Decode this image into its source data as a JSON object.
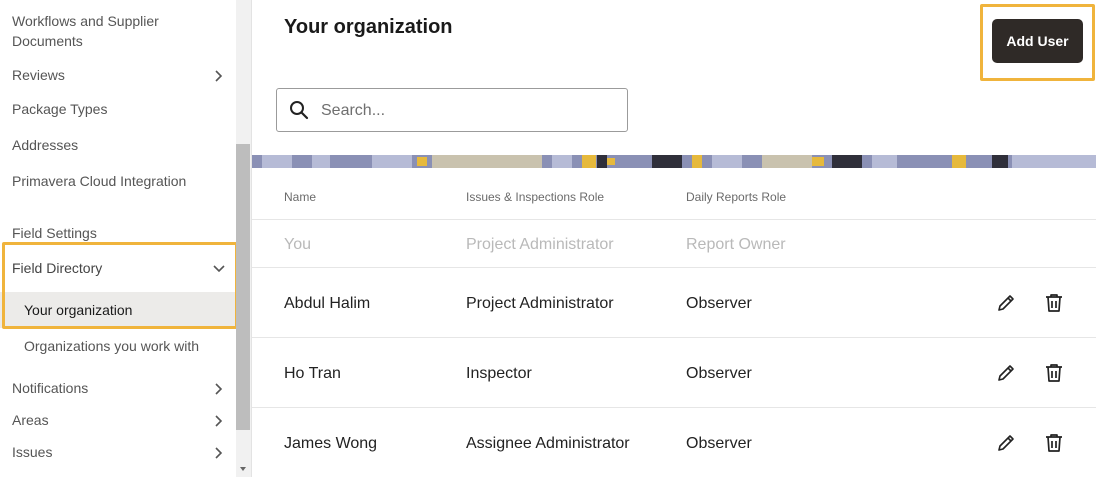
{
  "sidebar": {
    "items": [
      {
        "label": "Workflows and Supplier Documents",
        "chevron": false
      },
      {
        "label": "Reviews",
        "chevron": true
      },
      {
        "label": "Package Types",
        "chevron": false
      },
      {
        "label": "Addresses",
        "chevron": false
      },
      {
        "label": "Primavera Cloud Integration",
        "chevron": false
      },
      {
        "label": "Field Settings",
        "chevron": false
      },
      {
        "label": "Field Directory",
        "chevron": true,
        "expanded": true
      },
      {
        "label": "Your organization",
        "selected": true
      },
      {
        "label": "Organizations you work with"
      },
      {
        "label": "Notifications",
        "chevron": true
      },
      {
        "label": "Areas",
        "chevron": true
      },
      {
        "label": "Issues",
        "chevron": true
      }
    ]
  },
  "header": {
    "title": "Your organization",
    "add_user_label": "Add User"
  },
  "search": {
    "placeholder": "Search...",
    "value": ""
  },
  "table": {
    "columns": [
      "Name",
      "Issues & Inspections Role",
      "Daily Reports Role"
    ],
    "rows": [
      {
        "name": "You",
        "issues_role": "Project Administrator",
        "reports_role": "Report Owner",
        "muted": true
      },
      {
        "name": "Abdul Halim",
        "issues_role": "Project Administrator",
        "reports_role": "Observer"
      },
      {
        "name": "Ho Tran",
        "issues_role": "Inspector",
        "reports_role": "Observer"
      },
      {
        "name": "James Wong",
        "issues_role": "Assignee Administrator",
        "reports_role": "Observer"
      }
    ]
  },
  "icons": {
    "edit": "pencil-icon",
    "delete": "trash-icon",
    "search": "search-icon",
    "chevron": "chevron-right-icon"
  },
  "colors": {
    "highlight": "#f0b43c",
    "button_bg": "#2f2a27",
    "selected_bg": "#ecebe9"
  }
}
